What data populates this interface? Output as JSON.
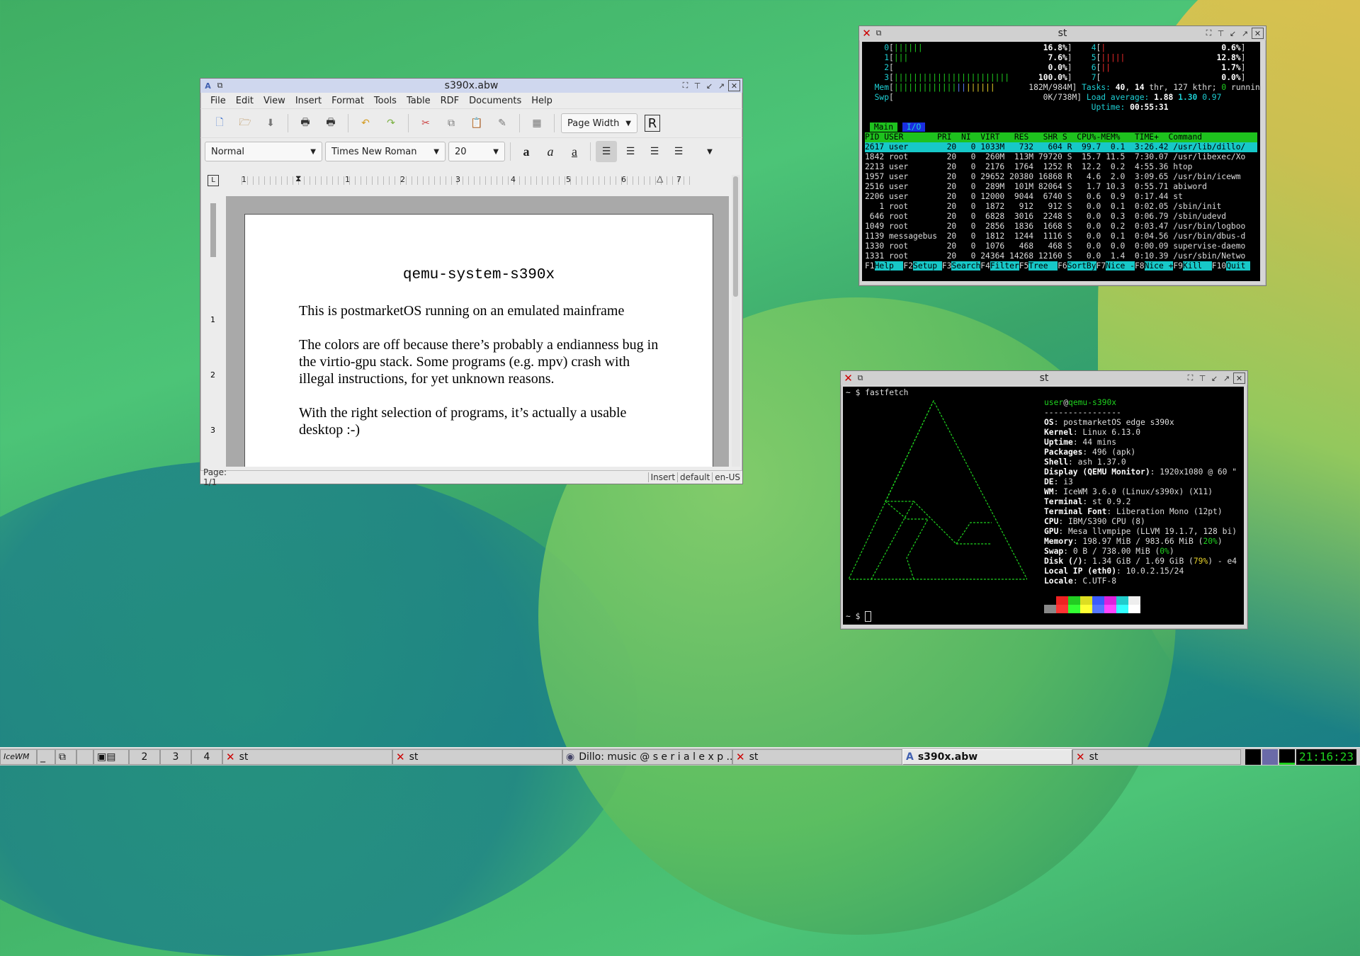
{
  "abiword": {
    "title": "s390x.abw",
    "menu": [
      "File",
      "Edit",
      "View",
      "Insert",
      "Format",
      "Tools",
      "Table",
      "RDF",
      "Documents",
      "Help"
    ],
    "zoom": "Page Width",
    "style": "Normal",
    "font": "Times New Roman",
    "size": "20",
    "ruler": [
      "1",
      "1",
      "2",
      "3",
      "4",
      "5",
      "6",
      "7"
    ],
    "vruler": [
      "1",
      "2",
      "3"
    ],
    "heading": "qemu-system-s390x",
    "p1": "This is postmarketOS running on an emulated mainframe",
    "p2": "The colors are off because there’s probably a endianness bug in the virtio-gpu stack. Some programs (e.g. mpv) crash with illegal instructions, for yet unknown reasons.",
    "p3": "With the right selection of programs, it’s actually a usable desktop :-)",
    "status_page": "Page: 1/1",
    "status_mode": "Insert",
    "status_style": "default",
    "status_lang": "en-US"
  },
  "htop": {
    "title": "st",
    "cpu_rows": [
      {
        "id": "0",
        "bar": "||||||",
        "pct": "16.8%",
        "id2": "4",
        "bar2": "|",
        "pct2": "0.6%"
      },
      {
        "id": "1",
        "bar": "|||",
        "pct": "7.6%",
        "id2": "5",
        "bar2": "|||||",
        "pct2": "12.8%"
      },
      {
        "id": "2",
        "bar": "",
        "pct": "0.0%",
        "id2": "6",
        "bar2": "||",
        "pct2": "1.7%"
      },
      {
        "id": "3",
        "bar": "||||||||||||||||||||||||",
        "pct": "100.0%",
        "id2": "7",
        "bar2": "",
        "pct2": "0.0%"
      }
    ],
    "mem": "182M/984M",
    "swp": "0K/738M",
    "tasks_label": "Tasks:",
    "tasks": "40",
    "thr": "14",
    "kthr": "thr, 127 kthr;",
    "running": "0",
    "running_label": "running",
    "load_label": "Load average:",
    "load1": "1.88",
    "load5": "1.30",
    "load15": "0.97",
    "uptime_label": "Uptime:",
    "uptime": "00:55:31",
    "tab_main": "Main",
    "tab_io": "I/O",
    "columns": "PID USER       PRI  NI  VIRT   RES   SHR S  CPU%-MEM%   TIME+  Command",
    "processes": [
      "2617 user        20   0 1033M   732   604 R  99.7  0.1  3:26.42 /usr/lib/dillo/",
      "1842 root        20   0  260M  113M 79720 S  15.7 11.5  7:30.07 /usr/libexec/Xo",
      "2213 user        20   0  2176  1764  1252 R  12.2  0.2  4:55.36 htop",
      "1957 user        20   0 29652 20380 16868 R   4.6  2.0  3:09.65 /usr/bin/icewm",
      "2516 user        20   0  289M  101M 82064 S   1.7 10.3  0:55.71 abiword",
      "2206 user        20   0 12000  9044  6740 S   0.6  0.9  0:17.44 st",
      "   1 root        20   0  1872   912   912 S   0.0  0.1  0:02.05 /sbin/init",
      " 646 root        20   0  6828  3016  2248 S   0.0  0.3  0:06.79 /sbin/udevd",
      "1049 root        20   0  2856  1836  1668 S   0.0  0.2  0:03.47 /usr/bin/logboo",
      "1139 messagebus  20   0  1812  1244  1116 S   0.0  0.1  0:04.56 /usr/bin/dbus-d",
      "1330 root        20   0  1076   468   468 S   0.0  0.0  0:00.09 supervise-daemo",
      "1331 root        20   0 24364 14268 12160 S   0.0  1.4  0:10.39 /usr/sbin/Netwo"
    ],
    "fkeys": [
      {
        "k": "F1",
        "l": "Help  "
      },
      {
        "k": "F2",
        "l": "Setup "
      },
      {
        "k": "F3",
        "l": "Search"
      },
      {
        "k": "F4",
        "l": "Filter"
      },
      {
        "k": "F5",
        "l": "Tree  "
      },
      {
        "k": "F6",
        "l": "SortBy"
      },
      {
        "k": "F7",
        "l": "Nice -"
      },
      {
        "k": "F8",
        "l": "Nice +"
      },
      {
        "k": "F9",
        "l": "Kill  "
      },
      {
        "k": "F10",
        "l": "Quit "
      }
    ]
  },
  "fastfetch": {
    "title": "st",
    "prompt": "~ $ fastfetch",
    "user": "user",
    "host": "qemu-s390x",
    "dashes": "----------------",
    "rows": [
      {
        "k": "OS",
        "v": "postmarketOS edge s390x"
      },
      {
        "k": "Kernel",
        "v": "Linux 6.13.0"
      },
      {
        "k": "Uptime",
        "v": "44 mins"
      },
      {
        "k": "Packages",
        "v": "496 (apk)"
      },
      {
        "k": "Shell",
        "v": "ash 1.37.0"
      },
      {
        "k": "Display (QEMU Monitor)",
        "v": "1920x1080 @ 60 \""
      },
      {
        "k": "DE",
        "v": "i3"
      },
      {
        "k": "WM",
        "v": "IceWM 3.6.0 (Linux/s390x) (X11)"
      },
      {
        "k": "Terminal",
        "v": "st 0.9.2"
      },
      {
        "k": "Terminal Font",
        "v": "Liberation Mono (12pt)"
      },
      {
        "k": "CPU",
        "v": "IBM/S390 CPU (8)"
      },
      {
        "k": "GPU",
        "v": "Mesa llvmpipe (LLVM 19.1.7, 128 bi)"
      },
      {
        "k": "Memory",
        "v": "198.97 MiB / 983.66 MiB (",
        "pct": "20%",
        "tail": ")"
      },
      {
        "k": "Swap",
        "v": "0 B / 738.00 MiB (",
        "pct": "0%",
        "tail": ")"
      },
      {
        "k": "Disk (/)",
        "v": "1.34 GiB / 1.69 GiB (",
        "pct": "79%",
        "tail": ") - e4"
      },
      {
        "k": "Local IP (eth0)",
        "v": "10.0.2.15/24"
      },
      {
        "k": "Locale",
        "v": "C.UTF-8"
      }
    ],
    "colors": [
      "#000000",
      "#ee2222",
      "#22cc22",
      "#dddd22",
      "#3b5bff",
      "#dd22dd",
      "#22cccc",
      "#eeeeee"
    ],
    "colors2": [
      "#888888",
      "#ff3333",
      "#33ff33",
      "#ffff33",
      "#5577ff",
      "#ff44ff",
      "#33ffff",
      "#ffffff"
    ],
    "prompt2": "~ $ "
  },
  "taskbar": {
    "workspaces": [
      "2",
      "3",
      "4"
    ],
    "tasks": [
      "st",
      "st",
      "Dillo: music @ s e r i a l e x p ...",
      "st",
      "s390x.abw",
      "st"
    ],
    "clock": "21:16:23"
  },
  "colors": {
    "term_green": "#1fd21f",
    "cyan": "#17c8c8"
  }
}
